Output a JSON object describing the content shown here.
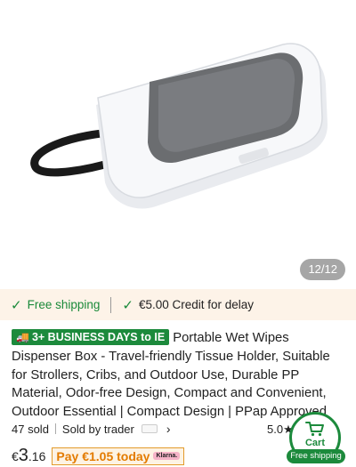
{
  "gallery": {
    "counter": "12/12",
    "image_alt": "Portable wet wipes dispenser box product photo"
  },
  "shipping_bar": {
    "free_shipping": "Free shipping",
    "credit": "€5.00 Credit for delay"
  },
  "product": {
    "badge": "3+ BUSINESS DAYS to IE",
    "title": "Portable Wet Wipes Dispenser Box - Travel-friendly Tissue Holder, Suitable for Strollers, Cribs, and Outdoor Use, Durable PP Material, Odor-free Design, Compact and Convenient, Outdoor Essential | Compact Design | PPap Approved",
    "sold": "47 sold",
    "seller": "Sold by trader",
    "rating": "5.0",
    "price_currency": "€",
    "price_whole": "3",
    "price_cents": ".16",
    "pay_later": "Pay €1.05 today",
    "klarna": "Klarna."
  },
  "cart_button": {
    "label": "Cart",
    "free_shipping": "Free shipping"
  },
  "colors": {
    "green": "#1c8a3c",
    "orange": "#e37b00",
    "cream": "#fdf3e8"
  }
}
